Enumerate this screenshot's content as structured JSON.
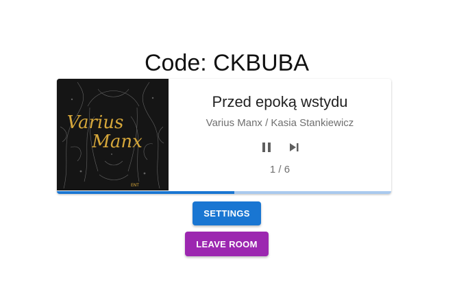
{
  "room": {
    "code_text": "Code: CKBUBA"
  },
  "player": {
    "cover_text": "Varius Manx",
    "title": "Przed epoką wstydu",
    "artist": "Varius Manx / Kasia Stankiewicz",
    "counter": "1 / 6",
    "progress_fraction": 0.53,
    "pause_icon": "pause-icon",
    "skip_icon": "skip-next-icon"
  },
  "buttons": {
    "settings_label": "SETTINGS",
    "leave_label": "LEAVE ROOM"
  },
  "colors": {
    "primary": "#1976d2",
    "secondary": "#9c27b0",
    "progress_buffer": "#a9c9ee"
  }
}
